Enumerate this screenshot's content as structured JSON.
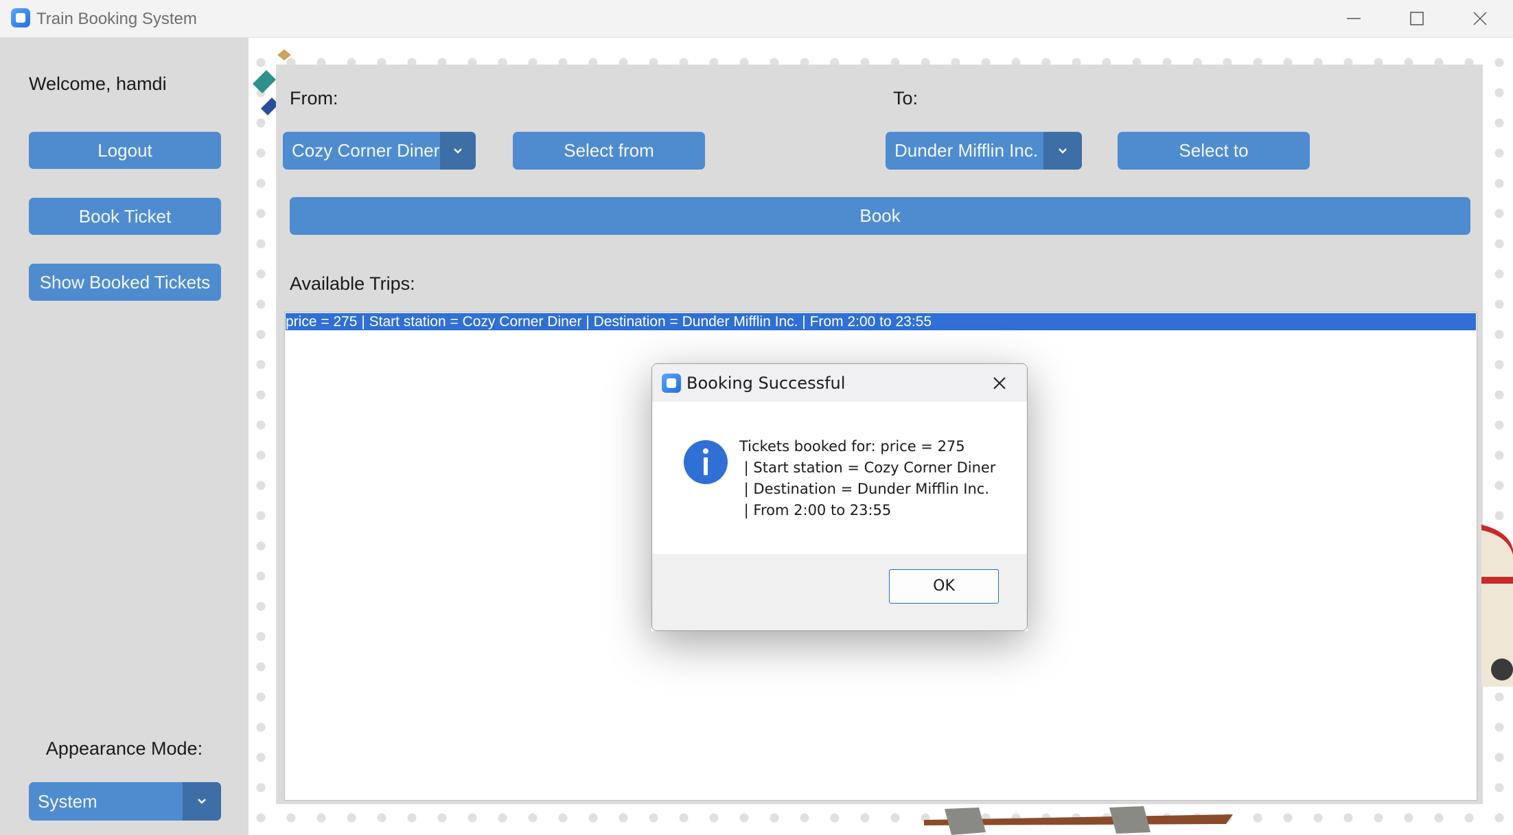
{
  "window": {
    "title": "Train Booking System"
  },
  "sidebar": {
    "welcome": "Welcome, hamdi",
    "logout_label": "Logout",
    "book_ticket_label": "Book Ticket",
    "show_booked_label": "Show Booked Tickets",
    "appearance_label": "Appearance Mode:",
    "appearance_value": "System"
  },
  "booking": {
    "from_label": "From:",
    "to_label": "To:",
    "from_value": "Cozy Corner Diner",
    "to_value": "Dunder Mifflin Inc.",
    "select_from_label": "Select from",
    "select_to_label": "Select to",
    "book_label": "Book",
    "trips_label": "Available Trips:",
    "trips": [
      "price = 275 | Start station = Cozy Corner Diner | Destination = Dunder Mifflin Inc. | From 2:00 to 23:55"
    ]
  },
  "dialog": {
    "title": "Booking Successful",
    "message": "Tickets booked for: price = 275\n | Start station = Cozy Corner Diner\n | Destination = Dunder Mifflin Inc.\n | From 2:00 to 23:55",
    "ok_label": "OK",
    "icon": "info-icon"
  },
  "colors": {
    "button": "#4f8ccf",
    "dropdown_arrow": "#3d6ea6",
    "selection": "#2f6fd6",
    "panel": "#dbdbdb"
  }
}
